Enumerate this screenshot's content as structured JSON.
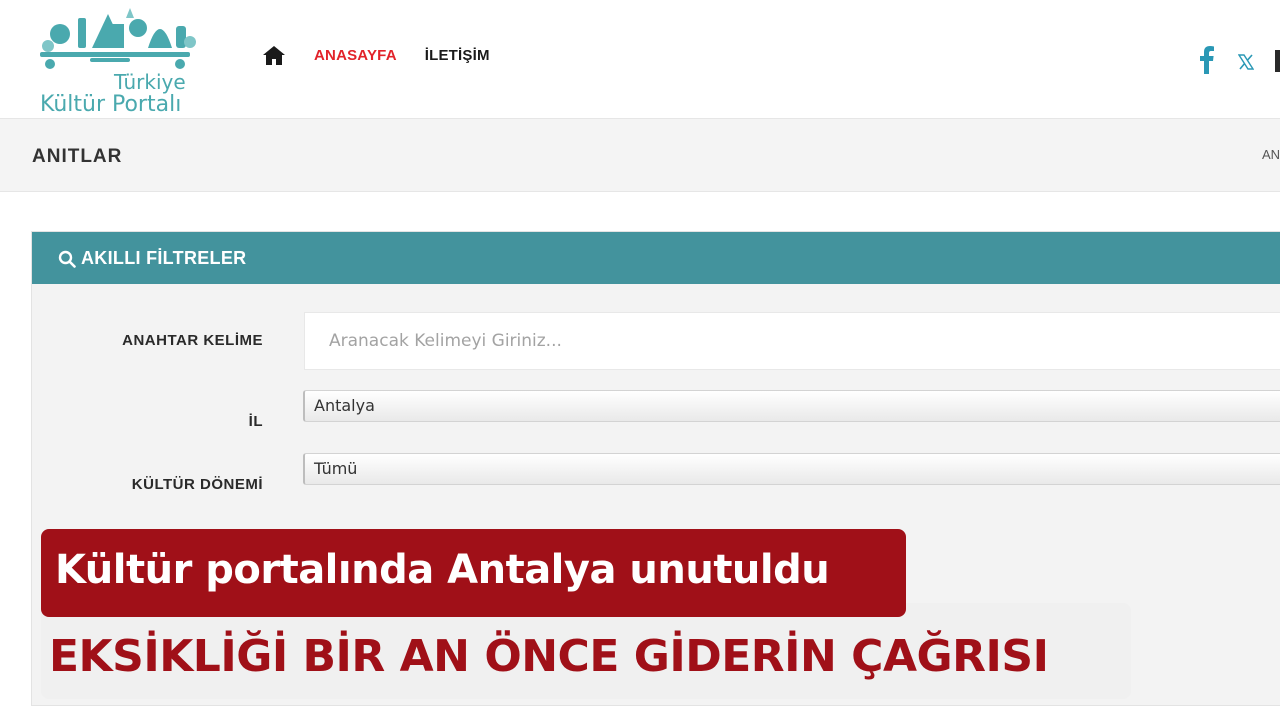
{
  "header": {
    "logo": {
      "line1": "Türkiye",
      "line2": "Kültür Portalı"
    },
    "nav": {
      "home_icon": "home-icon",
      "items": [
        {
          "label": "ANASAYFA",
          "active": true
        },
        {
          "label": "İLETİŞİM",
          "active": false
        }
      ]
    },
    "social": {
      "icons": [
        "facebook-icon",
        "x-twitter-icon"
      ]
    }
  },
  "breadcrumb_bar": {
    "page_title": "ANITLAR",
    "crumb_right": "AN"
  },
  "filters": {
    "title": "AKILLI FİLTRELER",
    "title_icon": "search-icon",
    "keyword": {
      "label": "ANAHTAR KELİME",
      "value": "",
      "placeholder": "Aranacak Kelimeyi Giriniz..."
    },
    "province": {
      "label": "İL",
      "selected": "Antalya"
    },
    "culture_period": {
      "label": "KÜLTÜR DÖNEMİ",
      "selected": "Tümü"
    }
  },
  "overlay": {
    "headline": "Kültür portalında Antalya unutuldu",
    "subheadline": "EKSİKLİĞİ BİR AN ÖNCE GİDERİN ÇAĞRISI"
  },
  "colors": {
    "teal_header": "#43939d",
    "nav_active": "#e2232a",
    "banner_red": "#a01018",
    "logo_teal": "#4aa9ae"
  }
}
